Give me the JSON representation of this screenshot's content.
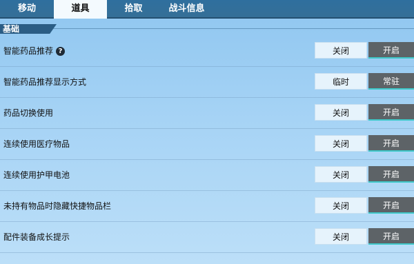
{
  "tabs": [
    {
      "label": "移动",
      "active": false
    },
    {
      "label": "道具",
      "active": true
    },
    {
      "label": "拾取",
      "active": false
    },
    {
      "label": "战斗信息",
      "active": false
    }
  ],
  "section": {
    "title": "基础"
  },
  "rows": [
    {
      "label": "智能药品推荐",
      "has_help": true,
      "off_label": "关闭",
      "on_label": "开启",
      "selected": "on"
    },
    {
      "label": "智能药品推荐显示方式",
      "has_help": false,
      "off_label": "临时",
      "on_label": "常驻",
      "selected": "on"
    },
    {
      "label": "药品切换使用",
      "has_help": false,
      "off_label": "关闭",
      "on_label": "开启",
      "selected": "on"
    },
    {
      "label": "连续使用医疗物品",
      "has_help": false,
      "off_label": "关闭",
      "on_label": "开启",
      "selected": "on"
    },
    {
      "label": "连续使用护甲电池",
      "has_help": false,
      "off_label": "关闭",
      "on_label": "开启",
      "selected": "on"
    },
    {
      "label": "未持有物品时隐藏快捷物品栏",
      "has_help": false,
      "off_label": "关闭",
      "on_label": "开启",
      "selected": "on"
    },
    {
      "label": "配件装备成长提示",
      "has_help": false,
      "off_label": "关闭",
      "on_label": "开启",
      "selected": "on"
    }
  ],
  "help_icon": {
    "glyph": "?",
    "icon": "question-icon"
  },
  "colors": {
    "tab_bar": "#356f97",
    "active_tab": "#f4fafe",
    "section_bar": "#2b5d85",
    "selected_option": "#5d6367",
    "selected_accent": "#3ec9c9",
    "unselected_option": "#e6f3fc"
  }
}
